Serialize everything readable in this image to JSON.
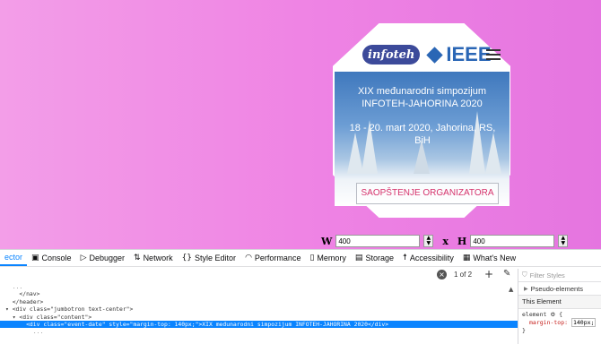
{
  "page": {
    "logo_left": "infoteh",
    "logo_right": "IEEE",
    "hero_title": "XIX međunarodni simpozijum INFOTEH-JAHORINA 2020",
    "hero_date": "18 - 20. mart 2020, Jahorina, RS, BiH",
    "notice_button": "SAOPŠTENJE ORGANIZATORA"
  },
  "responsive": {
    "w_label": "W",
    "w_value": "400",
    "x_label": "x",
    "h_label": "H",
    "h_value": "400"
  },
  "devtools": {
    "tabs": [
      {
        "label": "ector",
        "icon": ""
      },
      {
        "label": "Console",
        "icon": "console-icon"
      },
      {
        "label": "Debugger",
        "icon": "debugger-icon"
      },
      {
        "label": "Network",
        "icon": "network-icon"
      },
      {
        "label": "Style Editor",
        "icon": "style-editor-icon"
      },
      {
        "label": "Performance",
        "icon": "performance-icon"
      },
      {
        "label": "Memory",
        "icon": "memory-icon"
      },
      {
        "label": "Storage",
        "icon": "storage-icon"
      },
      {
        "label": "Accessibility",
        "icon": "accessibility-icon"
      },
      {
        "label": "What's New",
        "icon": "gift-icon"
      }
    ],
    "search_count": "1 of 2",
    "markup_lines": [
      "    </nav>",
      "  </header>",
      "▾ <div class=\"jumbotron text-center\">",
      "  ▾ <div class=\"content\">",
      "      <div class=\"event-date\" style=\"margin-top: 140px;\">XIX međunarodni simpozijum INFOTEH-JAHORINA 2020</div>"
    ],
    "filter_placeholder": "Filter Styles",
    "pseudo_elements": "Pseudo-elements",
    "this_element": "This Element",
    "rule_selector": "element",
    "rule_property": "margin-top:",
    "rule_value": "140px;",
    "rule_close": "}"
  }
}
